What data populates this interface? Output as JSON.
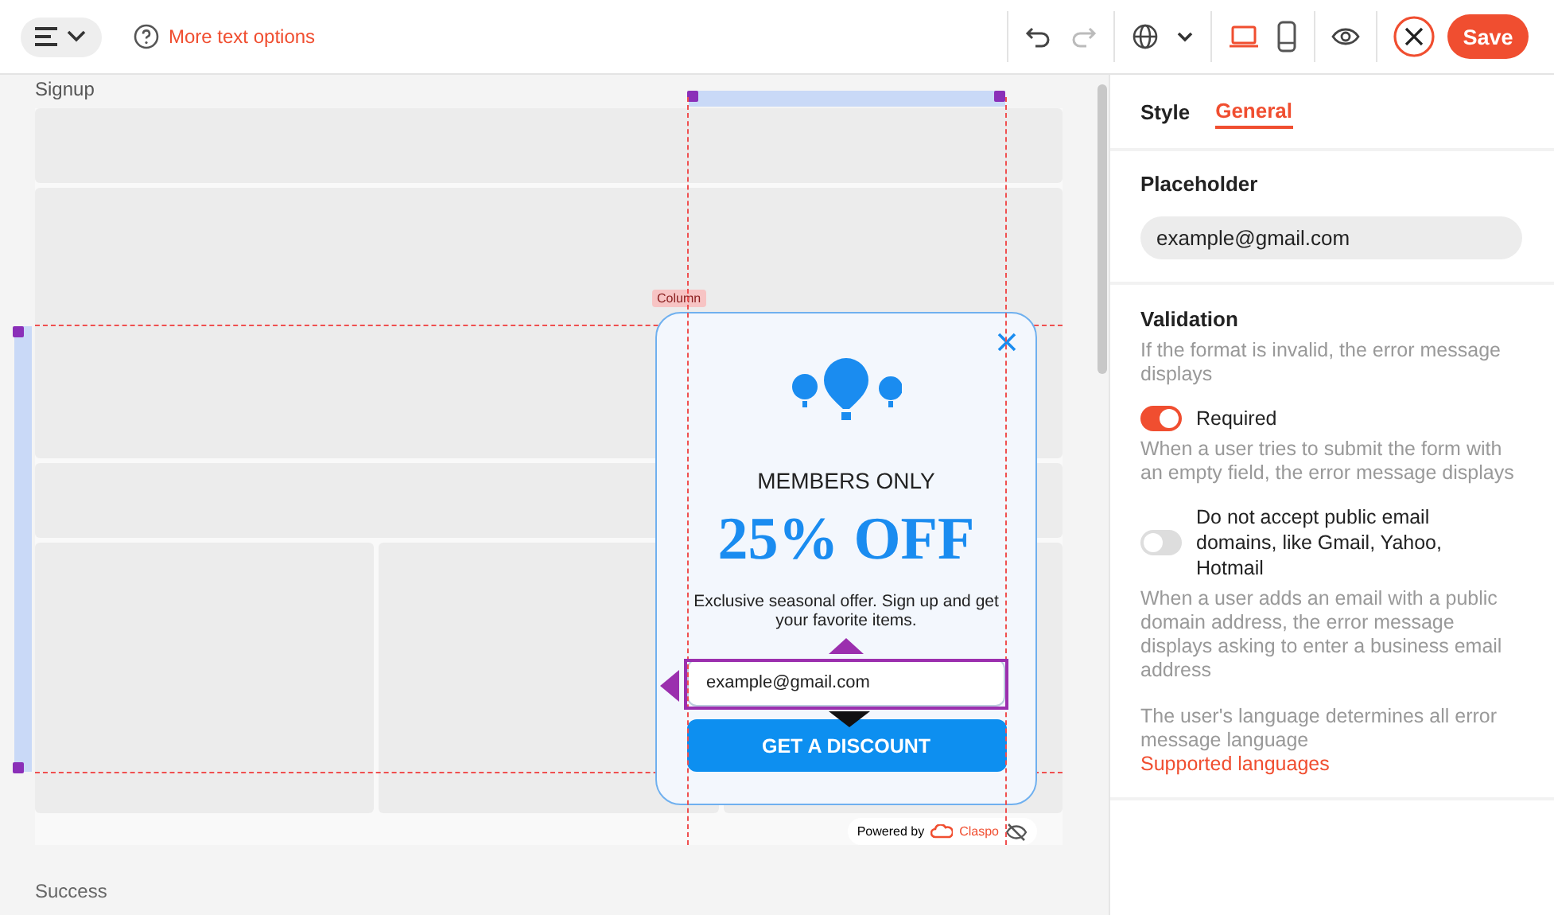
{
  "toolbar": {
    "text_options_link": "More text options",
    "devices": [
      {
        "kind": "laptop",
        "selected": true
      },
      {
        "kind": "phone",
        "selected": false
      }
    ],
    "redo_disabled": true,
    "save_button": "Save"
  },
  "canvas": {
    "sections": [
      {
        "label": "Signup"
      },
      {
        "label": "Success"
      }
    ],
    "column_label": "Column",
    "popup": {
      "heading": "MEMBERS ONLY",
      "offer": "25% OFF",
      "text": "Exclusive seasonal offer. Sign up and get your favorite items.",
      "email_placeholder": "example@gmail.com",
      "button": "GET A DISCOUNT"
    },
    "branding": {
      "prefix": "Powered by",
      "brand": "Claspo"
    }
  },
  "panel": {
    "tabs": [
      {
        "label": "Style",
        "selected": false
      },
      {
        "label": "General",
        "selected": true
      }
    ],
    "placeholder": {
      "title": "Placeholder",
      "value": "example@gmail.com"
    },
    "validation": {
      "title": "Validation",
      "description": "If the format is invalid, the error message displays",
      "toggles": [
        {
          "label": "Required",
          "on": true,
          "description": "When a user tries to submit the form with an empty field, the error message displays"
        },
        {
          "label": "Do not accept public email domains, like Gmail, Yahoo, Hotmail",
          "on": false,
          "description": "When a user adds an email with a public domain address, the error message displays asking to enter a business email address"
        }
      ],
      "note": "The user's language determines all error message language",
      "link": "Supported languages"
    }
  }
}
